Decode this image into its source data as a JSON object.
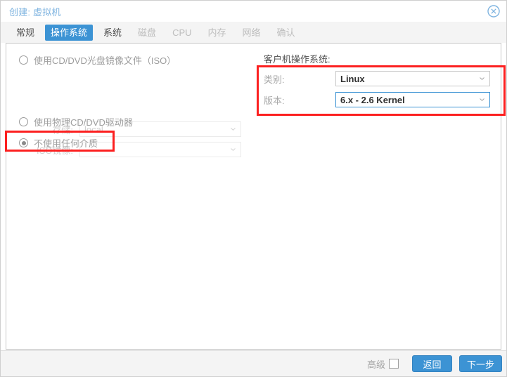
{
  "window": {
    "title": "创建: 虚拟机",
    "close_icon": "close-circle-icon"
  },
  "tabs": [
    {
      "label": "常规",
      "state": "normal"
    },
    {
      "label": "操作系统",
      "state": "active"
    },
    {
      "label": "系统",
      "state": "normal"
    },
    {
      "label": "磁盘",
      "state": "disabled"
    },
    {
      "label": "CPU",
      "state": "disabled"
    },
    {
      "label": "内存",
      "state": "disabled"
    },
    {
      "label": "网络",
      "state": "disabled"
    },
    {
      "label": "确认",
      "state": "disabled"
    }
  ],
  "media": {
    "iso_option_label": "使用CD/DVD光盘镜像文件（ISO）",
    "storage_label": "存储:",
    "storage_value": "local",
    "iso_image_label": "ISO镜像:",
    "iso_image_value": "",
    "physical_option_label": "使用物理CD/DVD驱动器",
    "none_option_label": "不使用任何介质",
    "selected": "none"
  },
  "guest_os": {
    "heading": "客户机操作系统:",
    "type_label": "类别:",
    "type_value": "Linux",
    "version_label": "版本:",
    "version_value": "6.x - 2.6 Kernel"
  },
  "footer": {
    "advanced_label": "高级",
    "advanced_checked": false,
    "back_label": "返回",
    "next_label": "下一步"
  },
  "colors": {
    "accent": "#3c93d4",
    "highlight": "#fc2020",
    "title": "#7fb4e0"
  }
}
